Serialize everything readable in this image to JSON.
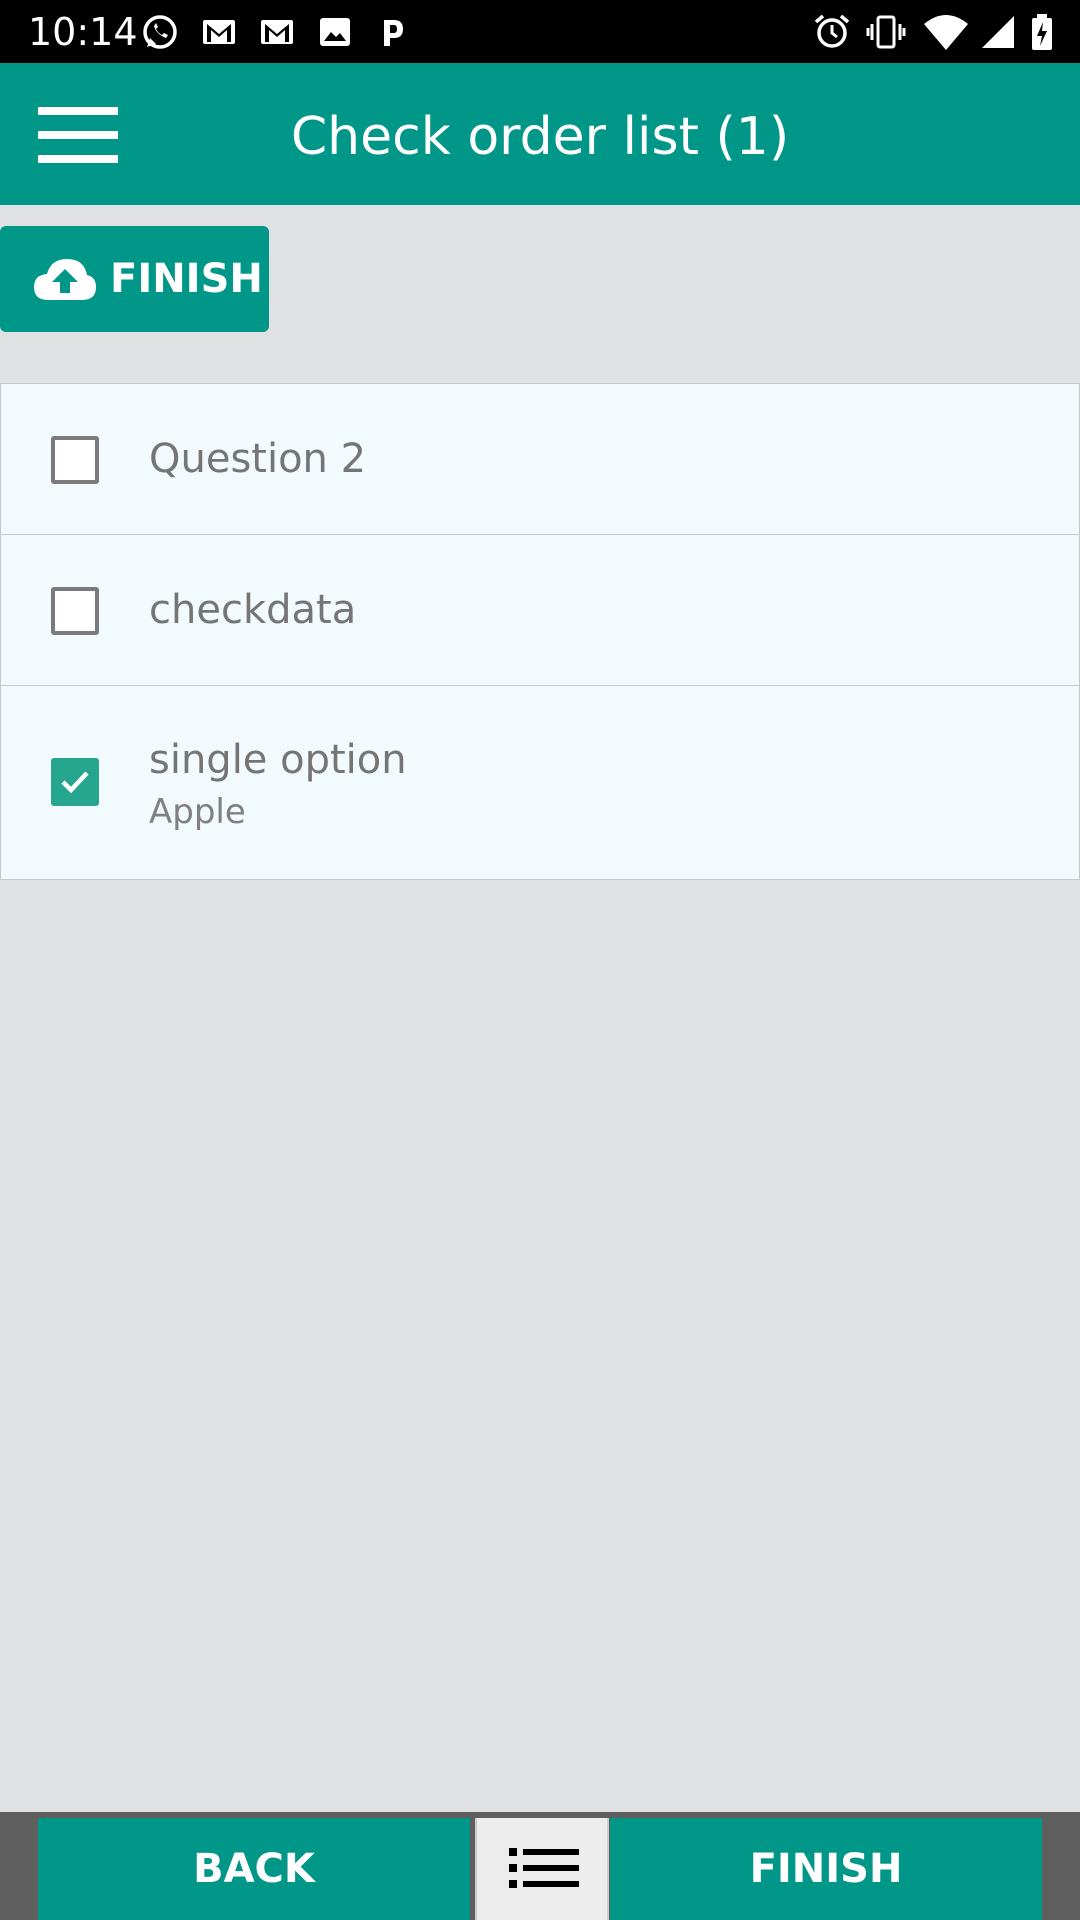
{
  "status_bar": {
    "time": "10:14",
    "left_icons": [
      "whatsapp-icon",
      "gmail-icon",
      "gmail-icon",
      "image-icon",
      "p-icon"
    ],
    "right_icons": [
      "alarm-icon",
      "vibrate-icon",
      "wifi-icon",
      "signal-icon",
      "battery-icon"
    ]
  },
  "app_bar": {
    "title": "Check order list (1)",
    "menu_icon": "hamburger-menu-icon"
  },
  "top_finish": {
    "label": "FINISH",
    "icon": "cloud-upload-icon"
  },
  "list": {
    "items": [
      {
        "label": "Question 2",
        "checked": false
      },
      {
        "label": "checkdata",
        "checked": false
      },
      {
        "label": "single option",
        "sub": "Apple",
        "checked": true
      }
    ]
  },
  "bottom_bar": {
    "back_label": "BACK",
    "finish_label": "FINISH",
    "list_icon": "list-icon"
  },
  "colors": {
    "primary": "#009688",
    "checkbox_checked": "#26a58f",
    "row_background": "#f2fafd",
    "page_background": "#e0e1e3"
  }
}
